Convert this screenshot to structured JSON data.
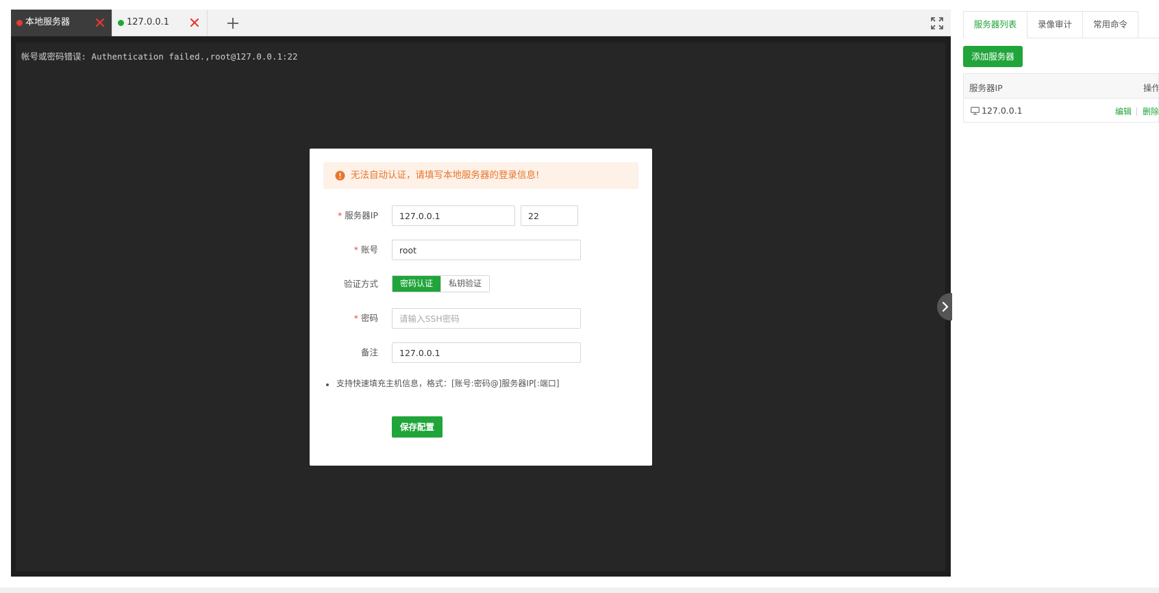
{
  "tabs": [
    {
      "label": "本地服务器",
      "status_color": "#e53935",
      "active": true
    },
    {
      "label": "127.0.0.1",
      "status_color": "#20a53a",
      "active": false
    }
  ],
  "terminal": {
    "output": "帐号或密码错误: Authentication failed.,root@127.0.0.1:22"
  },
  "modal": {
    "alert_text": "无法自动认证，请填写本地服务器的登录信息!",
    "fields": {
      "server_ip_label": "服务器IP",
      "server_ip_value": "127.0.0.1",
      "port_value": "22",
      "account_label": "账号",
      "account_value": "root",
      "auth_label": "验证方式",
      "auth_options": [
        "密码认证",
        "私钥验证"
      ],
      "auth_selected": "密码认证",
      "password_label": "密码",
      "password_placeholder": "请输入SSH密码",
      "remark_label": "备注",
      "remark_value": "127.0.0.1"
    },
    "tip": "支持快速填充主机信息，格式：[账号:密码@]服务器IP[:端口]",
    "save_label": "保存配置"
  },
  "side": {
    "tabs": [
      "服务器列表",
      "录像审计",
      "常用命令"
    ],
    "active_tab": "服务器列表",
    "add_button": "添加服务器",
    "table": {
      "headers": [
        "服务器IP",
        "操作"
      ],
      "rows": [
        {
          "ip": "127.0.0.1",
          "edit": "编辑",
          "delete": "删除"
        }
      ]
    }
  },
  "colors": {
    "accent": "#20a53a",
    "warning": "#e8762d",
    "danger": "#e53935",
    "terminal_bg": "#262626"
  }
}
